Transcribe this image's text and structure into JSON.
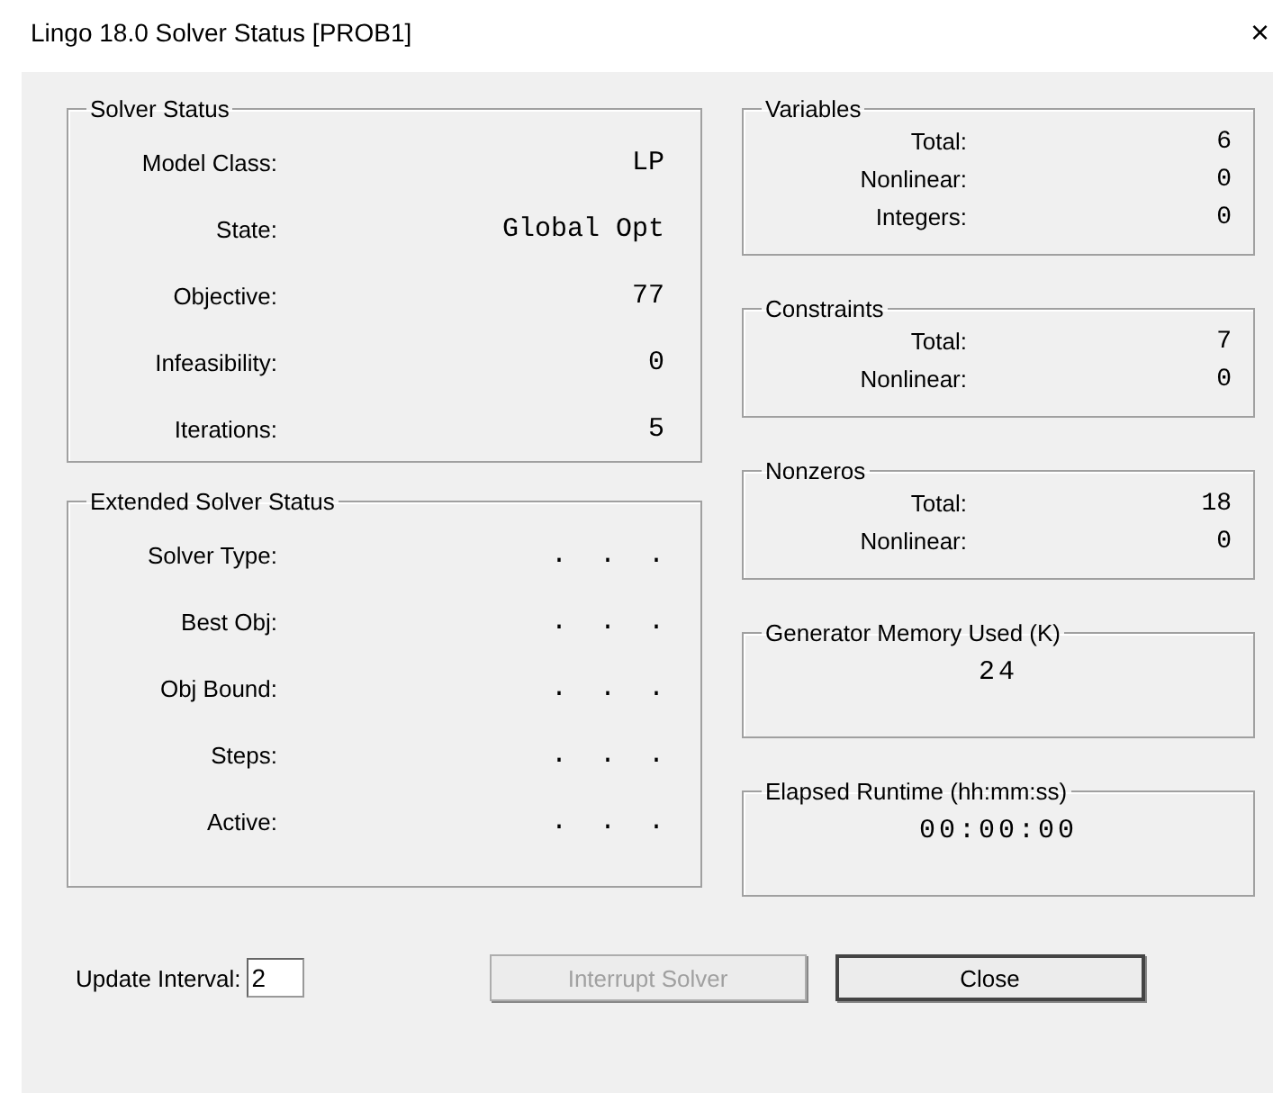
{
  "window": {
    "title": "Lingo 18.0 Solver Status [PROB1]",
    "close": "×"
  },
  "left_groups": [
    {
      "title": "Solver Status",
      "rows": [
        {
          "label": "Model Class:",
          "value": "LP"
        },
        {
          "label": "State:",
          "value": "Global Opt"
        },
        {
          "label": "Objective:",
          "value": "77"
        },
        {
          "label": "Infeasibility:",
          "value": "0"
        },
        {
          "label": "Iterations:",
          "value": "5"
        }
      ]
    },
    {
      "title": "Extended Solver Status",
      "rows": [
        {
          "label": "Solver Type:",
          "value": ".  .  ."
        },
        {
          "label": "Best Obj:",
          "value": ".  .  ."
        },
        {
          "label": "Obj Bound:",
          "value": ".  .  ."
        },
        {
          "label": "Steps:",
          "value": ".  .  ."
        },
        {
          "label": "Active:",
          "value": ".  .  ."
        }
      ]
    }
  ],
  "right_groups": [
    {
      "kind": "rows",
      "title": "Variables",
      "rows": [
        {
          "label": "Total:",
          "value": "6"
        },
        {
          "label": "Nonlinear:",
          "value": "0"
        },
        {
          "label": "Integers:",
          "value": "0"
        }
      ]
    },
    {
      "kind": "rows",
      "title": "Constraints",
      "rows": [
        {
          "label": "Total:",
          "value": "7"
        },
        {
          "label": "Nonlinear:",
          "value": "0"
        }
      ]
    },
    {
      "kind": "rows",
      "title": "Nonzeros",
      "rows": [
        {
          "label": "Total:",
          "value": "18"
        },
        {
          "label": "Nonlinear:",
          "value": "0"
        }
      ]
    },
    {
      "kind": "single",
      "title": "Generator Memory Used (K)",
      "value": "24"
    },
    {
      "kind": "single",
      "title": "Elapsed Runtime (hh:mm:ss)",
      "value": "00:00:00"
    }
  ],
  "update_interval": {
    "label": "Update Interval:",
    "value": "2"
  },
  "buttons": [
    {
      "label": "Interrupt Solver",
      "disabled": true,
      "default": false
    },
    {
      "label": "Close",
      "disabled": false,
      "default": true
    }
  ]
}
